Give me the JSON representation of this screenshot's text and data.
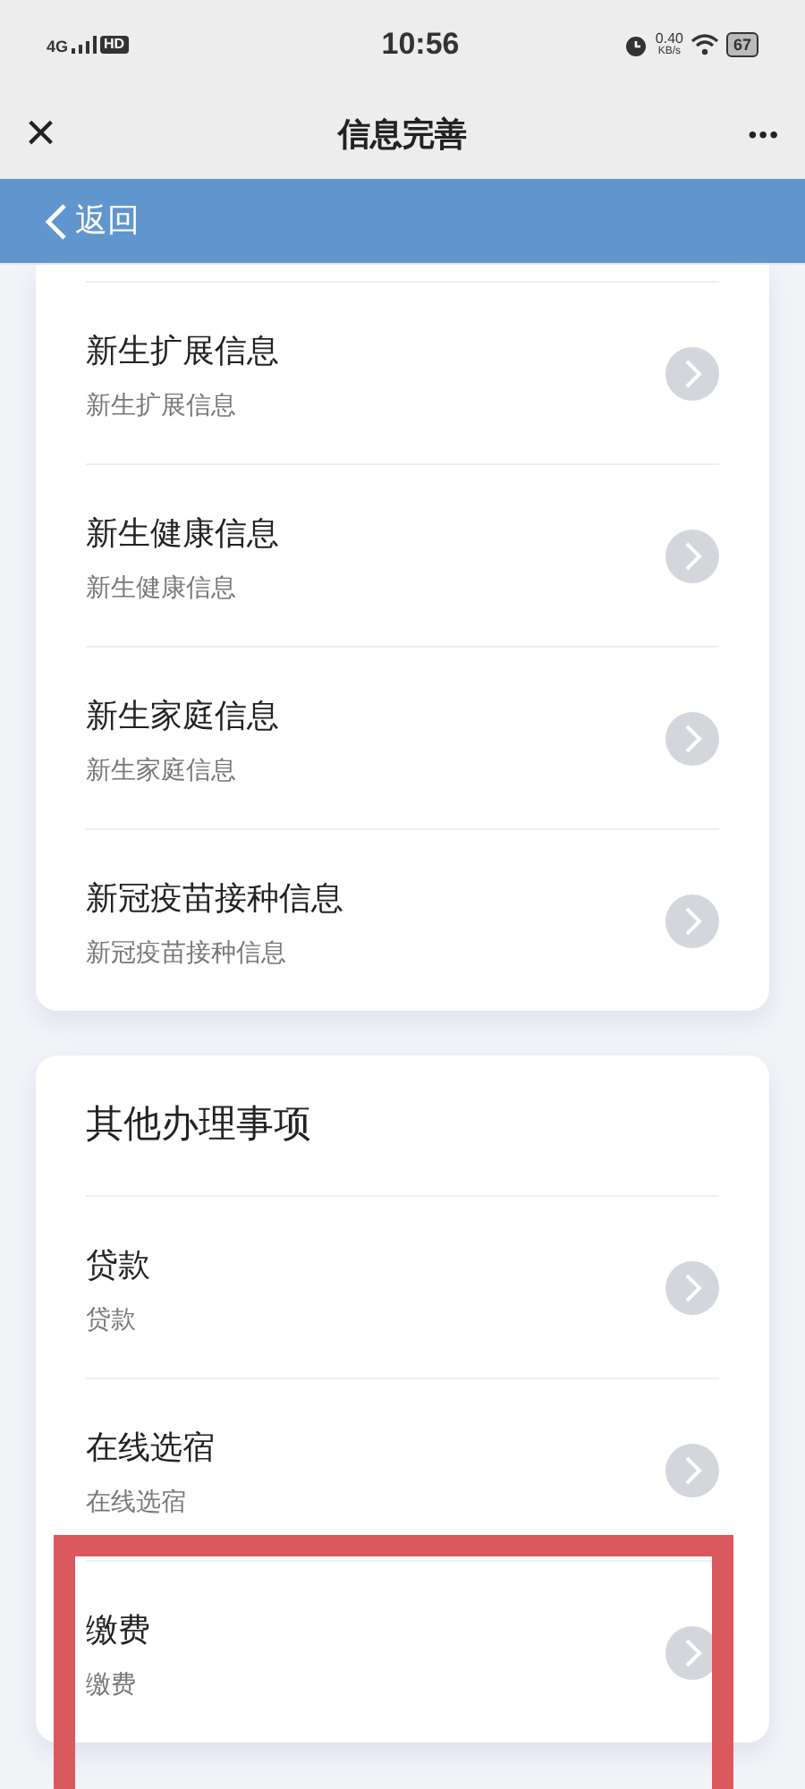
{
  "status_bar": {
    "network": "4G",
    "hd_badge": "HD",
    "time": "10:56",
    "speed_value": "0.40",
    "speed_unit": "KB/s",
    "battery": "67"
  },
  "header": {
    "close": "×",
    "title": "信息完善",
    "more": "•••"
  },
  "back_bar": {
    "label": "返回"
  },
  "sections": [
    {
      "items": [
        {
          "name": "新生扩展信息",
          "subtitle": "新生扩展信息",
          "highlighted": false
        },
        {
          "name": "新生健康信息",
          "subtitle": "新生健康信息",
          "highlighted": false
        },
        {
          "name": "新生家庭信息",
          "subtitle": "新生家庭信息",
          "highlighted": false
        },
        {
          "name": "新冠疫苗接种信息",
          "subtitle": "新冠疫苗接种信息",
          "highlighted": false
        }
      ]
    },
    {
      "title": "其他办理事项",
      "items": [
        {
          "name": "贷款",
          "subtitle": "贷款",
          "highlighted": false
        },
        {
          "name": "在线选宿",
          "subtitle": "在线选宿",
          "highlighted": false
        },
        {
          "name": "缴费",
          "subtitle": "缴费",
          "highlighted": true
        }
      ]
    }
  ]
}
